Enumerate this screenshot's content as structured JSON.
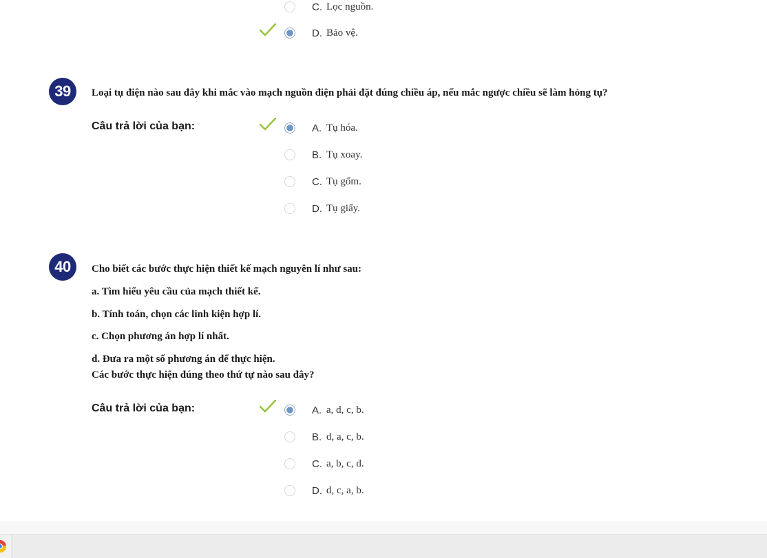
{
  "prev_question": {
    "options": [
      {
        "letter": "C.",
        "text": "Lọc nguồn.",
        "selected": false,
        "checked": false
      },
      {
        "letter": "D.",
        "text": "Bảo vệ.",
        "selected": true,
        "checked": true
      }
    ]
  },
  "questions": [
    {
      "number": "39",
      "text_lines": [
        "Loại tụ điện nào sau đây khi mắc vào mạch nguồn điện phải đặt đúng chiều áp, nếu mắc ngược chiều sẽ làm hỏng tụ?"
      ],
      "answer_label": "Câu trả lời của bạn:",
      "options": [
        {
          "letter": "A.",
          "text": "Tụ hóa.",
          "selected": true,
          "checked": true
        },
        {
          "letter": "B.",
          "text": "Tụ xoay.",
          "selected": false,
          "checked": false
        },
        {
          "letter": "C.",
          "text": "Tụ gốm.",
          "selected": false,
          "checked": false
        },
        {
          "letter": "D.",
          "text": "Tụ giấy.",
          "selected": false,
          "checked": false
        }
      ]
    },
    {
      "number": "40",
      "text_lines": [
        "Cho biết các bước thực hiện thiết kế mạch nguyên lí như sau:",
        "a. Tìm hiểu yêu cầu của mạch thiết kế.",
        "b. Tính toán, chọn các linh kiện hợp lí.",
        "c. Chọn phương án hợp lí nhất.",
        "d. Đưa ra một số phương án để thực hiện.",
        "Các bước thực hiện đúng theo thứ tự nào sau đây?"
      ],
      "answer_label": "Câu trả lời của bạn:",
      "options": [
        {
          "letter": "A.",
          "text": "a, d, c, b.",
          "selected": true,
          "checked": true
        },
        {
          "letter": "B.",
          "text": "d, a, c, b.",
          "selected": false,
          "checked": false
        },
        {
          "letter": "C.",
          "text": "a, b, c, d.",
          "selected": false,
          "checked": false
        },
        {
          "letter": "D.",
          "text": "d, c, a, b.",
          "selected": false,
          "checked": false
        }
      ]
    }
  ],
  "colors": {
    "badge": "#1e2a78",
    "check": "#9bc53d",
    "radio_selected": "#6f95c9"
  },
  "taskbar": {
    "icon": "chrome-icon"
  }
}
